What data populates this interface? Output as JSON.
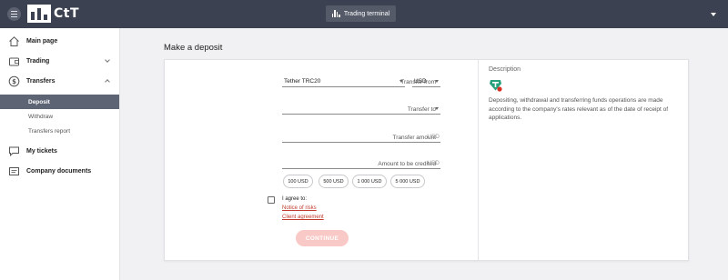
{
  "header": {
    "logo_text": "CtT",
    "terminal_button_label": "Trading terminal"
  },
  "sidebar": {
    "items": [
      {
        "label": "Main page",
        "icon": "home-icon"
      },
      {
        "label": "Trading",
        "icon": "wallet-icon"
      },
      {
        "label": "Transfers",
        "icon": "dollar-icon"
      },
      {
        "label": "My tickets",
        "icon": "chat-icon"
      },
      {
        "label": "Company documents",
        "icon": "document-icon"
      }
    ],
    "transfers_sub": [
      {
        "label": "Deposit",
        "active": true
      },
      {
        "label": "Withdraw",
        "active": false
      },
      {
        "label": "Transfers report",
        "active": false
      }
    ]
  },
  "main": {
    "page_title": "Make a deposit",
    "form": {
      "transfer_from_label": "Transfer from",
      "transfer_from_value": "Tether TRC20",
      "currency_value": "USD",
      "transfer_to_label": "Transfer to",
      "transfer_to_value": "",
      "transfer_amount_label": "Transfer amount",
      "transfer_amount_suffix": "USD",
      "amount_credited_label": "Amount to be credited",
      "amount_credited_suffix": "USD",
      "quick_amounts": [
        "100 USD",
        "500 USD",
        "1 000 USD",
        "5 000 USD"
      ],
      "agree_label": "I agree to:",
      "notice_link": "Notice of risks",
      "agreement_link": "Client agreement",
      "continue_label": "CONTINUE"
    },
    "description": {
      "title": "Description",
      "text": "Depositing, withdrawal and transferring funds operations are made according to the company's rates relevant as of the date of receipt of applications."
    }
  },
  "colors": {
    "topbar": "#3b4151",
    "active_nav": "#5d6473",
    "accent_red": "#c0392b",
    "continue_disabled": "#f8c9c6",
    "tether_green": "#26a17b"
  }
}
